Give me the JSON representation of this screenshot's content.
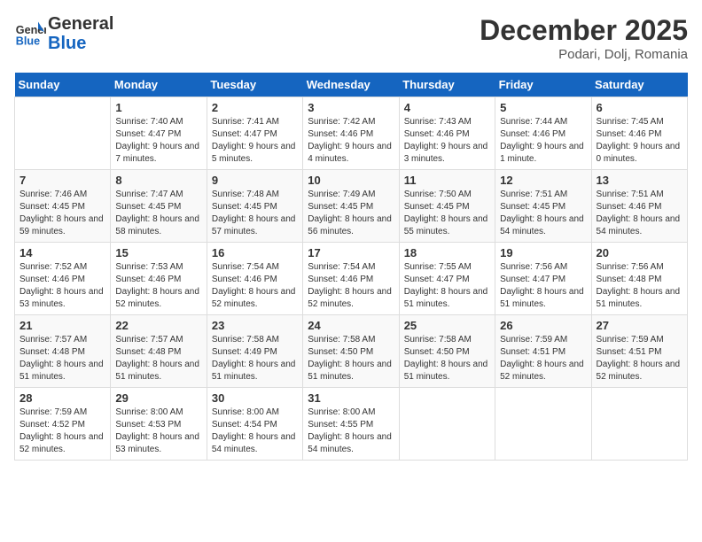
{
  "header": {
    "logo_general": "General",
    "logo_blue": "Blue",
    "month_title": "December 2025",
    "location": "Podari, Dolj, Romania"
  },
  "weekdays": [
    "Sunday",
    "Monday",
    "Tuesday",
    "Wednesday",
    "Thursday",
    "Friday",
    "Saturday"
  ],
  "weeks": [
    [
      {
        "day": "",
        "sunrise": "",
        "sunset": "",
        "daylight": ""
      },
      {
        "day": "1",
        "sunrise": "Sunrise: 7:40 AM",
        "sunset": "Sunset: 4:47 PM",
        "daylight": "Daylight: 9 hours and 7 minutes."
      },
      {
        "day": "2",
        "sunrise": "Sunrise: 7:41 AM",
        "sunset": "Sunset: 4:47 PM",
        "daylight": "Daylight: 9 hours and 5 minutes."
      },
      {
        "day": "3",
        "sunrise": "Sunrise: 7:42 AM",
        "sunset": "Sunset: 4:46 PM",
        "daylight": "Daylight: 9 hours and 4 minutes."
      },
      {
        "day": "4",
        "sunrise": "Sunrise: 7:43 AM",
        "sunset": "Sunset: 4:46 PM",
        "daylight": "Daylight: 9 hours and 3 minutes."
      },
      {
        "day": "5",
        "sunrise": "Sunrise: 7:44 AM",
        "sunset": "Sunset: 4:46 PM",
        "daylight": "Daylight: 9 hours and 1 minute."
      },
      {
        "day": "6",
        "sunrise": "Sunrise: 7:45 AM",
        "sunset": "Sunset: 4:46 PM",
        "daylight": "Daylight: 9 hours and 0 minutes."
      }
    ],
    [
      {
        "day": "7",
        "sunrise": "Sunrise: 7:46 AM",
        "sunset": "Sunset: 4:45 PM",
        "daylight": "Daylight: 8 hours and 59 minutes."
      },
      {
        "day": "8",
        "sunrise": "Sunrise: 7:47 AM",
        "sunset": "Sunset: 4:45 PM",
        "daylight": "Daylight: 8 hours and 58 minutes."
      },
      {
        "day": "9",
        "sunrise": "Sunrise: 7:48 AM",
        "sunset": "Sunset: 4:45 PM",
        "daylight": "Daylight: 8 hours and 57 minutes."
      },
      {
        "day": "10",
        "sunrise": "Sunrise: 7:49 AM",
        "sunset": "Sunset: 4:45 PM",
        "daylight": "Daylight: 8 hours and 56 minutes."
      },
      {
        "day": "11",
        "sunrise": "Sunrise: 7:50 AM",
        "sunset": "Sunset: 4:45 PM",
        "daylight": "Daylight: 8 hours and 55 minutes."
      },
      {
        "day": "12",
        "sunrise": "Sunrise: 7:51 AM",
        "sunset": "Sunset: 4:45 PM",
        "daylight": "Daylight: 8 hours and 54 minutes."
      },
      {
        "day": "13",
        "sunrise": "Sunrise: 7:51 AM",
        "sunset": "Sunset: 4:46 PM",
        "daylight": "Daylight: 8 hours and 54 minutes."
      }
    ],
    [
      {
        "day": "14",
        "sunrise": "Sunrise: 7:52 AM",
        "sunset": "Sunset: 4:46 PM",
        "daylight": "Daylight: 8 hours and 53 minutes."
      },
      {
        "day": "15",
        "sunrise": "Sunrise: 7:53 AM",
        "sunset": "Sunset: 4:46 PM",
        "daylight": "Daylight: 8 hours and 52 minutes."
      },
      {
        "day": "16",
        "sunrise": "Sunrise: 7:54 AM",
        "sunset": "Sunset: 4:46 PM",
        "daylight": "Daylight: 8 hours and 52 minutes."
      },
      {
        "day": "17",
        "sunrise": "Sunrise: 7:54 AM",
        "sunset": "Sunset: 4:46 PM",
        "daylight": "Daylight: 8 hours and 52 minutes."
      },
      {
        "day": "18",
        "sunrise": "Sunrise: 7:55 AM",
        "sunset": "Sunset: 4:47 PM",
        "daylight": "Daylight: 8 hours and 51 minutes."
      },
      {
        "day": "19",
        "sunrise": "Sunrise: 7:56 AM",
        "sunset": "Sunset: 4:47 PM",
        "daylight": "Daylight: 8 hours and 51 minutes."
      },
      {
        "day": "20",
        "sunrise": "Sunrise: 7:56 AM",
        "sunset": "Sunset: 4:48 PM",
        "daylight": "Daylight: 8 hours and 51 minutes."
      }
    ],
    [
      {
        "day": "21",
        "sunrise": "Sunrise: 7:57 AM",
        "sunset": "Sunset: 4:48 PM",
        "daylight": "Daylight: 8 hours and 51 minutes."
      },
      {
        "day": "22",
        "sunrise": "Sunrise: 7:57 AM",
        "sunset": "Sunset: 4:48 PM",
        "daylight": "Daylight: 8 hours and 51 minutes."
      },
      {
        "day": "23",
        "sunrise": "Sunrise: 7:58 AM",
        "sunset": "Sunset: 4:49 PM",
        "daylight": "Daylight: 8 hours and 51 minutes."
      },
      {
        "day": "24",
        "sunrise": "Sunrise: 7:58 AM",
        "sunset": "Sunset: 4:50 PM",
        "daylight": "Daylight: 8 hours and 51 minutes."
      },
      {
        "day": "25",
        "sunrise": "Sunrise: 7:58 AM",
        "sunset": "Sunset: 4:50 PM",
        "daylight": "Daylight: 8 hours and 51 minutes."
      },
      {
        "day": "26",
        "sunrise": "Sunrise: 7:59 AM",
        "sunset": "Sunset: 4:51 PM",
        "daylight": "Daylight: 8 hours and 52 minutes."
      },
      {
        "day": "27",
        "sunrise": "Sunrise: 7:59 AM",
        "sunset": "Sunset: 4:51 PM",
        "daylight": "Daylight: 8 hours and 52 minutes."
      }
    ],
    [
      {
        "day": "28",
        "sunrise": "Sunrise: 7:59 AM",
        "sunset": "Sunset: 4:52 PM",
        "daylight": "Daylight: 8 hours and 52 minutes."
      },
      {
        "day": "29",
        "sunrise": "Sunrise: 8:00 AM",
        "sunset": "Sunset: 4:53 PM",
        "daylight": "Daylight: 8 hours and 53 minutes."
      },
      {
        "day": "30",
        "sunrise": "Sunrise: 8:00 AM",
        "sunset": "Sunset: 4:54 PM",
        "daylight": "Daylight: 8 hours and 54 minutes."
      },
      {
        "day": "31",
        "sunrise": "Sunrise: 8:00 AM",
        "sunset": "Sunset: 4:55 PM",
        "daylight": "Daylight: 8 hours and 54 minutes."
      },
      {
        "day": "",
        "sunrise": "",
        "sunset": "",
        "daylight": ""
      },
      {
        "day": "",
        "sunrise": "",
        "sunset": "",
        "daylight": ""
      },
      {
        "day": "",
        "sunrise": "",
        "sunset": "",
        "daylight": ""
      }
    ]
  ]
}
